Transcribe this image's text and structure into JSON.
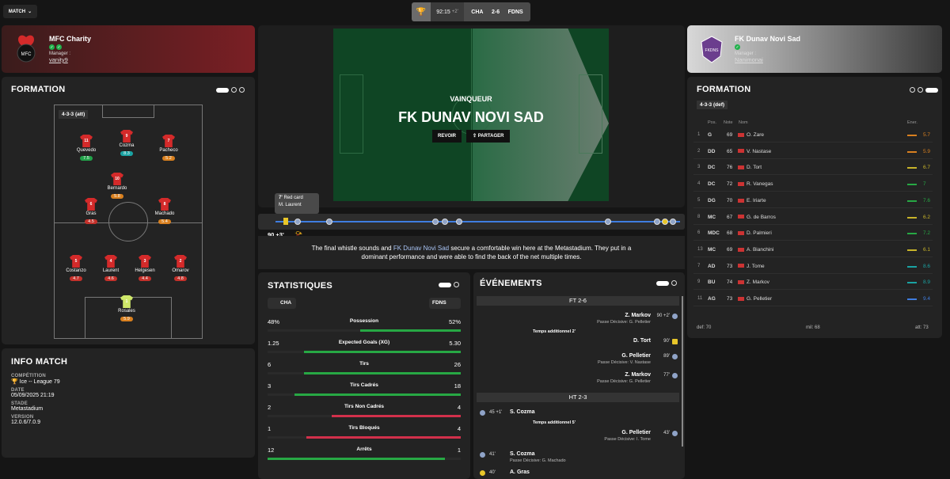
{
  "topbar": {
    "match_label": "MATCH",
    "time": "92:15",
    "added": "+2'",
    "home_short": "CHA",
    "score": "2-6",
    "away_short": "FDNS"
  },
  "home": {
    "name": "MFC Charity",
    "manager_label": "Manager :",
    "manager": "vanity9"
  },
  "away": {
    "name": "FK Dunav Novi Sad",
    "manager_label": "Manager :",
    "manager": "Nanimonai"
  },
  "formation_left": {
    "title": "FORMATION",
    "shape": "4-3-3 (att)",
    "players": [
      {
        "num": "11",
        "name": "Quevedo",
        "rating": "7.5",
        "color": "r-green"
      },
      {
        "num": "9",
        "name": "Cozma",
        "rating": "8.3",
        "color": "r-teal"
      },
      {
        "num": "7",
        "name": "Pacheco",
        "rating": "5.2",
        "color": "r-orange"
      },
      {
        "num": "10",
        "name": "Bernardo",
        "rating": "5.8",
        "color": "r-orange"
      },
      {
        "num": "6",
        "name": "Gras",
        "rating": "4.5",
        "color": "r-red"
      },
      {
        "num": "8",
        "name": "Machado",
        "rating": "5.4",
        "color": "r-orange"
      },
      {
        "num": "5",
        "name": "Costanzo",
        "rating": "4.7",
        "color": "r-red"
      },
      {
        "num": "4",
        "name": "Laurent",
        "rating": "4.6",
        "color": "r-red"
      },
      {
        "num": "3",
        "name": "Helgesen",
        "rating": "4.4",
        "color": "r-red"
      },
      {
        "num": "2",
        "name": "Omarov",
        "rating": "4.8",
        "color": "r-red"
      },
      {
        "num": "1",
        "name": "Rosales",
        "rating": "5.9",
        "color": "r-orange"
      }
    ]
  },
  "info": {
    "title": "INFO MATCH",
    "competition_label": "COMPÉTITION",
    "competition": "Ice -- League 79",
    "date_label": "DATE",
    "date": "05/09/2025 21:19",
    "stadium_label": "STADE",
    "stadium": "Metastadium",
    "version_label": "VERSION",
    "version": "12.0.6/7.0.9"
  },
  "center": {
    "winner_label": "VAINQUEUR",
    "winner": "FK DUNAV NOVI SAD",
    "replay": "REVOIR",
    "share": "PARTAGER",
    "tooltip_time": "7'",
    "tooltip_title": "Red card",
    "tooltip_player": "M. Laurent",
    "clock": "90 +3'",
    "summary_pre": "The final whistle sounds and ",
    "summary_team": "FK Dunav Novi Sad",
    "summary_post": " secure a comfortable win here at the Metastadium. They put in a dominant performance and were able to find the back of the net multiple times."
  },
  "stats": {
    "title": "STATISTIQUES",
    "home": "CHA",
    "away": "FDNS",
    "rows": [
      {
        "label": "Possession",
        "home": "48%",
        "away": "52%",
        "h": 0.48,
        "a": 0.52,
        "hc": "#2a2a2a",
        "ac": "#27a844"
      },
      {
        "label": "Expected Goals (XG)",
        "home": "1.25",
        "away": "5.30",
        "h": 0.19,
        "a": 0.81,
        "hc": "#2a2a2a",
        "ac": "#27a844"
      },
      {
        "label": "Tirs",
        "home": "6",
        "away": "26",
        "h": 0.19,
        "a": 0.81,
        "hc": "#2a2a2a",
        "ac": "#27a844"
      },
      {
        "label": "Tirs Cadrés",
        "home": "3",
        "away": "18",
        "h": 0.14,
        "a": 0.86,
        "hc": "#2a2a2a",
        "ac": "#27a844"
      },
      {
        "label": "Tirs Non Cadrés",
        "home": "2",
        "away": "4",
        "h": 0.33,
        "a": 0.67,
        "hc": "#2a2a2a",
        "ac": "#d2304b"
      },
      {
        "label": "Tirs Bloqués",
        "home": "1",
        "away": "4",
        "h": 0.2,
        "a": 0.8,
        "hc": "#2a2a2a",
        "ac": "#d2304b"
      },
      {
        "label": "Arrêts",
        "home": "12",
        "away": "1",
        "h": 0.92,
        "a": 0.08,
        "hc": "#27a844",
        "ac": "#2a2a2a"
      }
    ]
  },
  "events": {
    "title": "ÉVÉNEMENTS",
    "ft": "FT 2-6",
    "ht": "HT 2-3",
    "items": [
      {
        "name": "Z. Markov",
        "sub": "Passe Décisive: G. Pelletier",
        "time": "90 +2'"
      },
      {
        "name": "Temps additionnel 2'",
        "sub": "",
        "time": ""
      },
      {
        "name": "D. Tort",
        "sub": "",
        "time": "90'"
      },
      {
        "name": "G. Pelletier",
        "sub": "Passe Décisive: V. Nastase",
        "time": "89'"
      },
      {
        "name": "Z. Markov",
        "sub": "Passe Décisive: G. Pelletier",
        "time": "77'"
      },
      {
        "name": "S. Cozma",
        "sub": "",
        "time": "45 +1'"
      },
      {
        "name": "Temps additionnel 5'",
        "sub": "",
        "time": ""
      },
      {
        "name": "G. Pelletier",
        "sub": "Passe Décisive: I. Tome",
        "time": "43'"
      },
      {
        "name": "S. Cozma",
        "sub": "Passe Décisive: G. Machado",
        "time": "41'"
      },
      {
        "name": "A. Gras",
        "sub": "",
        "time": "40'"
      }
    ]
  },
  "formation_right": {
    "title": "FORMATION",
    "shape": "4-3-3 (def)",
    "col_pos": "Pos.",
    "col_note": "Note",
    "col_name": "Nom",
    "col_ener": "Ener.",
    "rows": [
      {
        "i": "1",
        "pos": "G",
        "note": "69",
        "name": "O. Zare",
        "en": "5.7",
        "ec": "#d9801f"
      },
      {
        "i": "2",
        "pos": "DD",
        "note": "65",
        "name": "V. Nastase",
        "en": "5.9",
        "ec": "#d9801f"
      },
      {
        "i": "3",
        "pos": "DC",
        "note": "76",
        "name": "D. Tort",
        "en": "6.7",
        "ec": "#c8b42a"
      },
      {
        "i": "4",
        "pos": "DC",
        "note": "72",
        "name": "R. Vanegas",
        "en": "7",
        "ec": "#27a844"
      },
      {
        "i": "5",
        "pos": "DG",
        "note": "70",
        "name": "E. Iriarte",
        "en": "7.6",
        "ec": "#27a844"
      },
      {
        "i": "8",
        "pos": "MC",
        "note": "67",
        "name": "G. de Barros",
        "en": "6.2",
        "ec": "#c8b42a"
      },
      {
        "i": "6",
        "pos": "MDC",
        "note": "68",
        "name": "D. Palmieri",
        "en": "7.2",
        "ec": "#27a844"
      },
      {
        "i": "13",
        "pos": "MC",
        "note": "69",
        "name": "A. Bianchini",
        "en": "6.1",
        "ec": "#c8b42a"
      },
      {
        "i": "7",
        "pos": "AD",
        "note": "73",
        "name": "J. Tome",
        "en": "8.6",
        "ec": "#1aa3a3"
      },
      {
        "i": "9",
        "pos": "BU",
        "note": "74",
        "name": "Z. Markov",
        "en": "8.9",
        "ec": "#1aa3a3"
      },
      {
        "i": "11",
        "pos": "AG",
        "note": "73",
        "name": "G. Pelletier",
        "en": "9.4",
        "ec": "#3f7de0"
      }
    ],
    "def": "def: 70",
    "mil": "mil: 68",
    "att": "att: 73"
  }
}
